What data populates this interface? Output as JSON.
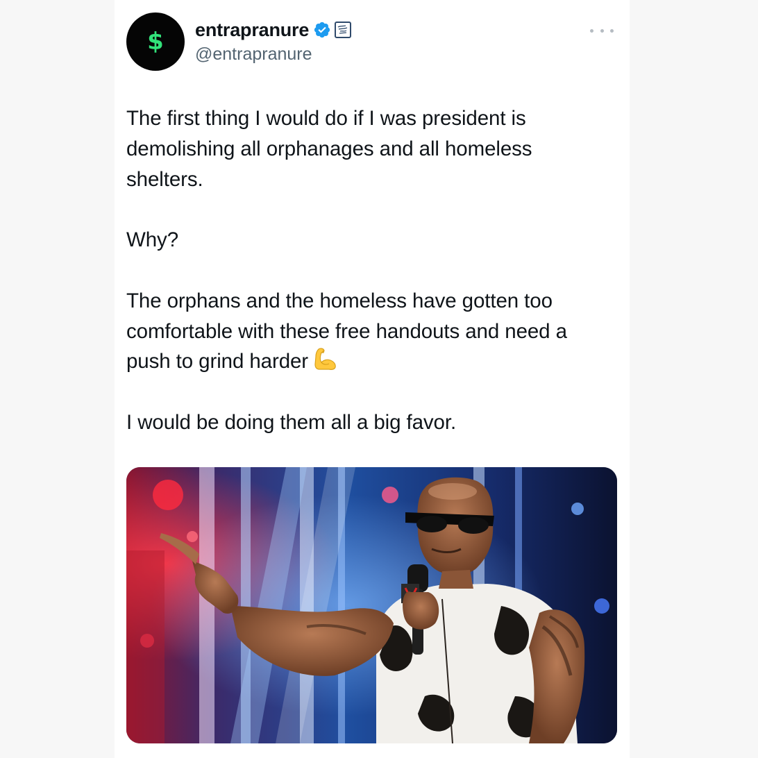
{
  "account": {
    "display_name": "entrapranure",
    "handle": "@entrapranure",
    "avatar_icon": "dollar-sign-icon",
    "avatar_glyph": "$",
    "verified_icon": "verified-badge-icon",
    "affiliate_icon": "affiliate-badge-icon"
  },
  "menu": {
    "icon": "more-options-icon"
  },
  "tweet": {
    "line1": "The first thing I would do if I was president is",
    "line2": "demolishing all orphanages and all homeless",
    "line3": "shelters.",
    "line4": "Why?",
    "line5": "The orphans and the homeless have gotten too",
    "line6": "comfortable with these free handouts and need a",
    "line7": "push to grind harder",
    "line8": "I would be doing them all a big favor.",
    "emoji_icon": "flexed-biceps-emoji"
  },
  "media": {
    "type": "photo"
  },
  "colors": {
    "text": "#0f1419",
    "secondary_text": "#536471",
    "verified_blue": "#1d9bf0",
    "avatar_bg": "#050505",
    "avatar_glyph": "#32e27a",
    "page_bg": "#f7f7f7",
    "card_bg": "#ffffff"
  }
}
